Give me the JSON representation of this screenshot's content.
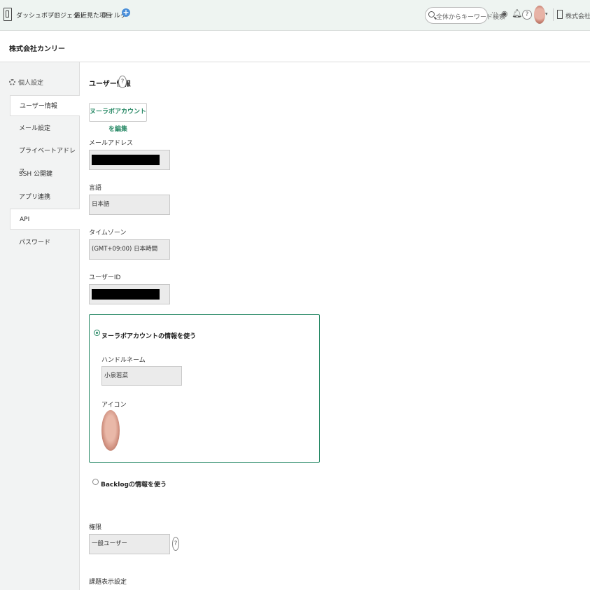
{
  "topbar": {
    "nav": [
      "ダッシュボード",
      "プロジェクト",
      "最近見た項目",
      "フィルタ"
    ],
    "plus": "+",
    "search_placeholder": "全体からキーワード検索",
    "more": "···",
    "help": "?",
    "caret": "▾",
    "org": "株式会社カンリー"
  },
  "org_name": "株式会社カンリー",
  "sidebar": {
    "heading": "個人設定",
    "items": [
      "ユーザー情報",
      "メール設定",
      "プライベートアドレス",
      "SSH 公開鍵",
      "アプリ連携",
      "API",
      "パスワード"
    ]
  },
  "main": {
    "title": "ユーザー情報",
    "help": "?",
    "edit_button": "ヌーラボアカウントを編集",
    "email_label": "メールアドレス",
    "language_label": "言語",
    "language_value": "日本語",
    "timezone_label": "タイムゾーン",
    "timezone_value": "(GMT+09:00) 日本時間",
    "userid_label": "ユーザーID",
    "option_nulab": "ヌーラボアカウントの情報を使う",
    "handle_label": "ハンドルネーム",
    "handle_value": "小泉若菜",
    "icon_label": "アイコン",
    "option_backlog": "Backlogの情報を使う",
    "role_label": "権限",
    "role_value": "一般ユーザー",
    "display_label": "課題表示設定"
  },
  "colors": {
    "accent": "#2a8a67",
    "topbar": "#eef4f1",
    "sidebar": "#f2f3f3"
  }
}
